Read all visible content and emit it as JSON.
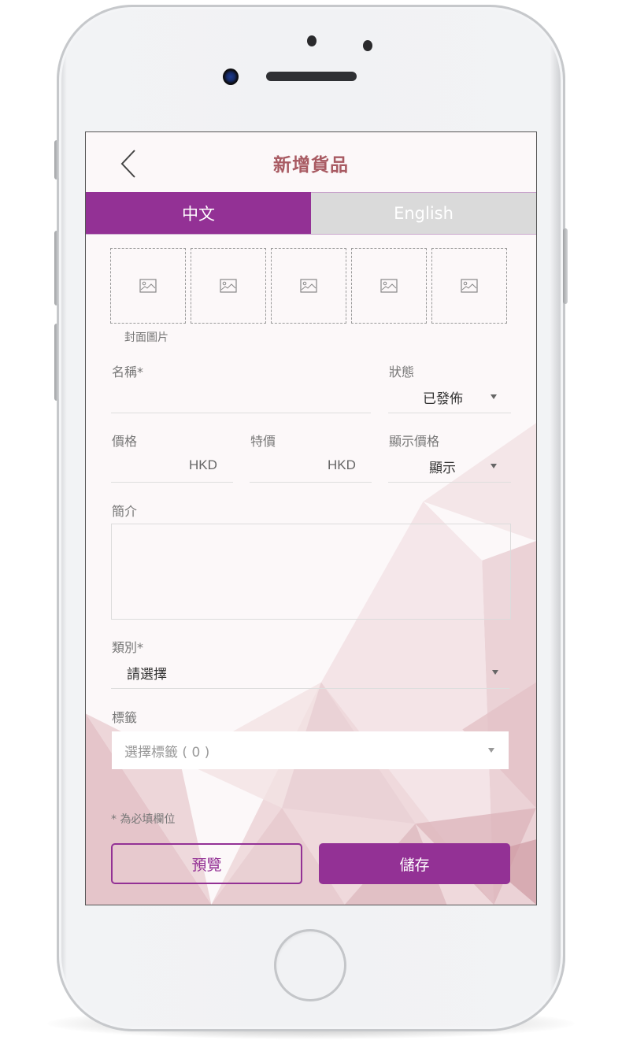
{
  "header": {
    "title": "新增貨品",
    "back_icon": "chevron-left-icon"
  },
  "tabs": [
    {
      "label": "中文",
      "active": true
    },
    {
      "label": "English",
      "active": false
    }
  ],
  "images": {
    "slot_count": 5,
    "slot_icon": "image-placeholder-icon",
    "cover_label": "封面圖片"
  },
  "form": {
    "name": {
      "label": "名稱*",
      "value": ""
    },
    "status": {
      "label": "狀態",
      "value": "已發佈"
    },
    "price": {
      "label": "價格",
      "currency": "HKD",
      "value": ""
    },
    "special_price": {
      "label": "特價",
      "currency": "HKD",
      "value": ""
    },
    "show_price": {
      "label": "顯示價格",
      "value": "顯示"
    },
    "description": {
      "label": "簡介",
      "value": ""
    },
    "category": {
      "label": "類別*",
      "value": "請選擇"
    },
    "tags": {
      "label": "標籤",
      "placeholder": "選擇標籤 ( 0 )"
    }
  },
  "required_note": "* 為必填欄位",
  "buttons": {
    "preview": "預覽",
    "save": "儲存"
  },
  "colors": {
    "accent": "#933195",
    "title": "#a85a62",
    "inactive_tab": "#dadada"
  }
}
